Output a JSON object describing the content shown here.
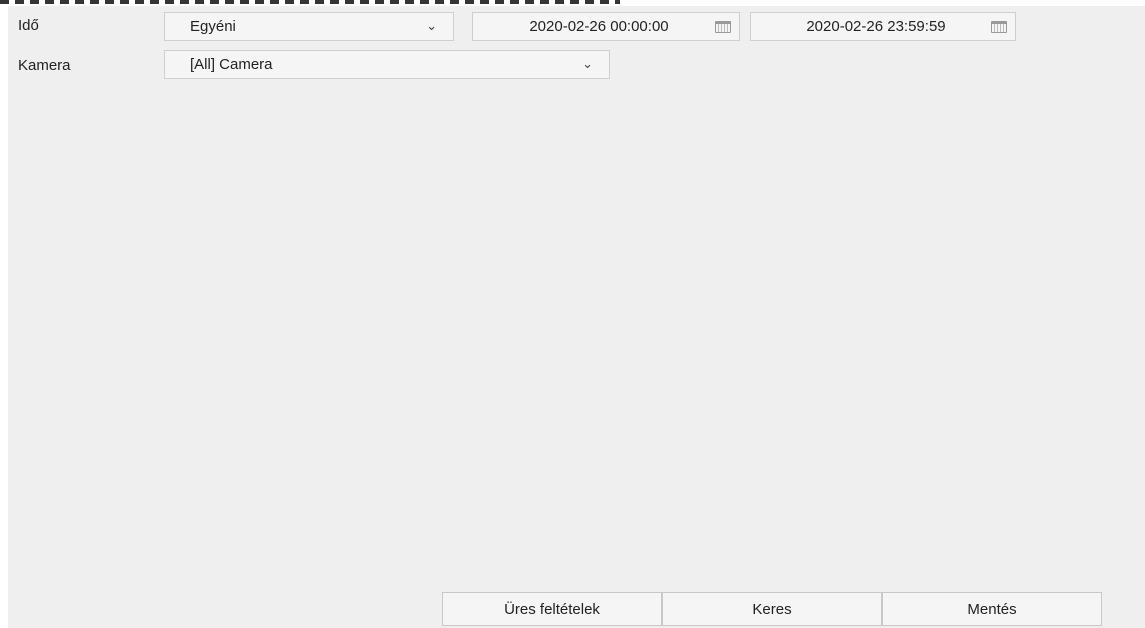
{
  "filters": {
    "time": {
      "label": "Idő",
      "mode_value": "Egyéni",
      "start": "2020-02-26 00:00:00",
      "end": "2020-02-26 23:59:59"
    },
    "camera": {
      "label": "Kamera",
      "value": "[All] Camera"
    }
  },
  "icons": {
    "dropdown": "chevron-down-icon",
    "calendar": "calendar-icon"
  },
  "actions": {
    "clear_label": "Üres feltételek",
    "search_label": "Keres",
    "save_label": "Mentés"
  }
}
